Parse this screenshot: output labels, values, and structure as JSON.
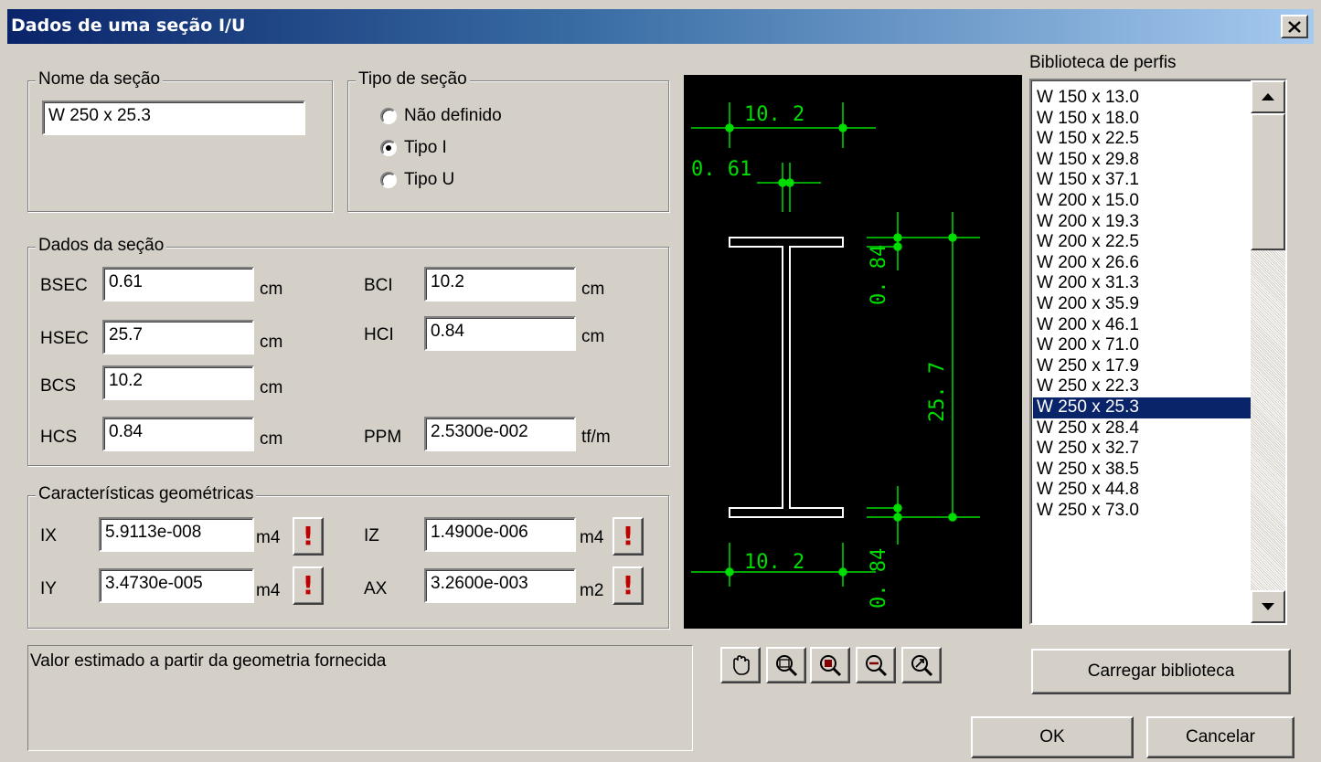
{
  "window": {
    "title": "Dados de uma seção I/U"
  },
  "nome_secao": {
    "legend": "Nome da seção",
    "value": "W 250 x 25.3"
  },
  "tipo_secao": {
    "legend": "Tipo de seção",
    "options": [
      "Não definido",
      "Tipo I",
      "Tipo U"
    ],
    "selected": "Tipo I"
  },
  "dados_secao": {
    "legend": "Dados da seção",
    "bsec": {
      "label": "BSEC",
      "value": "0.61",
      "unit": "cm"
    },
    "hsec": {
      "label": "HSEC",
      "value": "25.7",
      "unit": "cm"
    },
    "bcs": {
      "label": "BCS",
      "value": "10.2",
      "unit": "cm"
    },
    "hcs": {
      "label": "HCS",
      "value": "0.84",
      "unit": "cm"
    },
    "bci": {
      "label": "BCI",
      "value": "10.2",
      "unit": "cm"
    },
    "hci": {
      "label": "HCI",
      "value": "0.84",
      "unit": "cm"
    },
    "ppm": {
      "label": "PPM",
      "value": "2.5300e-002",
      "unit": "tf/m"
    }
  },
  "caracteristicas": {
    "legend": "Características geométricas",
    "ix": {
      "label": "IX",
      "value": "5.9113e-008",
      "unit": "m4"
    },
    "iy": {
      "label": "IY",
      "value": "3.4730e-005",
      "unit": "m4"
    },
    "iz": {
      "label": "IZ",
      "value": "1.4900e-006",
      "unit": "m4"
    },
    "ax": {
      "label": "AX",
      "value": "3.2600e-003",
      "unit": "m2"
    },
    "warning_icon": "exclamation-icon"
  },
  "drawing": {
    "colors": {
      "background": "#000000",
      "section": "#ffffff",
      "dimension": "#00ff00"
    },
    "dims": {
      "top_flange_width": "10. 2",
      "web_thickness": "0. 61",
      "top_flange_thickness": "0. 84",
      "height": "25. 7",
      "bottom_flange_width": "10. 2",
      "bottom_flange_thickness": "0. 84"
    }
  },
  "biblioteca": {
    "label": "Biblioteca de perfis",
    "items": [
      "W 150 x 13.0",
      "W 150 x 18.0",
      "W 150 x 22.5",
      "W 150 x 29.8",
      "W 150 x 37.1",
      "W 200 x 15.0",
      "W 200 x 19.3",
      "W 200 x 22.5",
      "W 200 x 26.6",
      "W 200 x 31.3",
      "W 200 x 35.9",
      "W 200 x 46.1",
      "W 200 x 71.0",
      "W 250 x 17.9",
      "W 250 x 22.3",
      "W 250 x 25.3",
      "W 250 x 28.4",
      "W 250 x 32.7",
      "W 250 x 38.5",
      "W 250 x 44.8",
      "W 250 x 73.0"
    ],
    "selected": "W 250 x 25.3"
  },
  "status_text": "Valor estimado a partir da geometria fornecida",
  "toolbar": {
    "icons": [
      "pan-icon",
      "zoom-window-icon",
      "zoom-fit-icon",
      "zoom-out-icon",
      "zoom-extents-icon"
    ]
  },
  "buttons": {
    "load_library": "Carregar biblioteca",
    "ok": "OK",
    "cancel": "Cancelar"
  }
}
